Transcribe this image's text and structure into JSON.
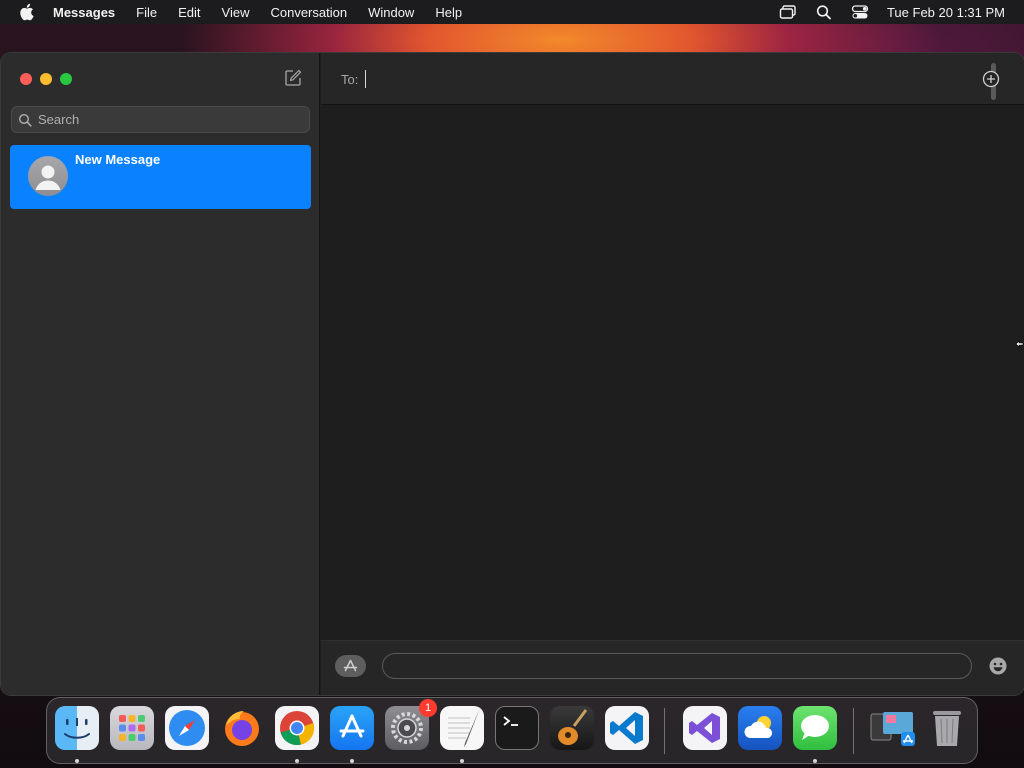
{
  "menubar": {
    "app_name": "Messages",
    "items": [
      "File",
      "Edit",
      "View",
      "Conversation",
      "Window",
      "Help"
    ],
    "clock": "Tue Feb 20  1:31 PM",
    "status_icons": [
      "screen-mirroring-icon",
      "spotlight-search-icon",
      "control-center-icon"
    ]
  },
  "sidebar": {
    "search_placeholder": "Search",
    "conversations": [
      {
        "name": "New Message",
        "selected": true
      }
    ]
  },
  "main": {
    "to_label": "To:",
    "to_value": "",
    "message_value": ""
  },
  "colors": {
    "accent": "#0a82ff",
    "window_bg": "#1e1e1e",
    "sidebar_bg": "#2c2c2c"
  },
  "dock": {
    "apps": [
      "Finder",
      "Launchpad",
      "Safari",
      "Firefox",
      "Google Chrome",
      "App Store",
      "System Settings",
      "TextEdit",
      "Terminal",
      "GarageBand",
      "Visual Studio Code",
      "Visual Studio",
      "Weather",
      "Messages",
      "Simulator",
      "Trash"
    ],
    "settings_badge": "1"
  }
}
